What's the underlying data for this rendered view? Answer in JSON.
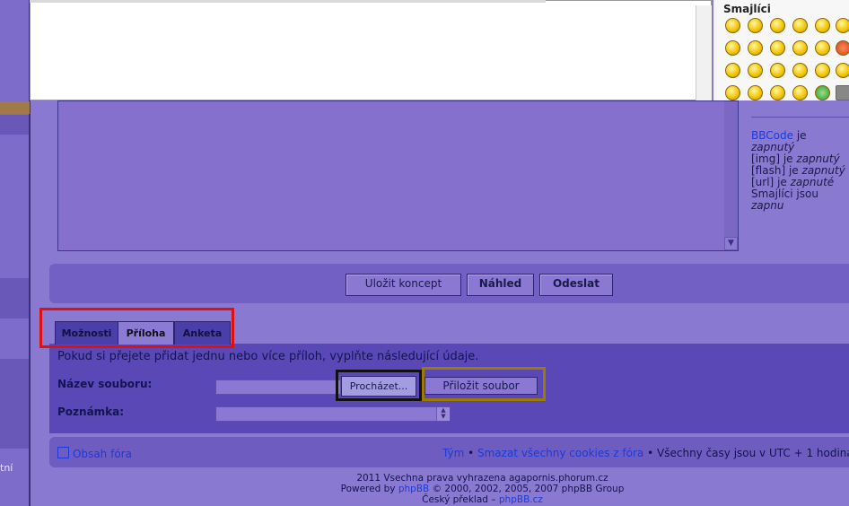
{
  "smilies": {
    "title": "Smajlíci"
  },
  "info": {
    "bbcode_label": "BBCode",
    "bbcode_state": "zapnutý",
    "img_label": "[img]",
    "img_state": "zapnutý",
    "flash_label": "[flash]",
    "flash_state": "zapnutý",
    "url_label": "[url]",
    "url_state": "zapnuté",
    "smilies_label": "Smajlíci jsou",
    "smilies_state": "zapnu",
    "connector": "je"
  },
  "buttons": {
    "draft": "Uložit koncept",
    "preview": "Náhled",
    "submit": "Odeslat"
  },
  "tabs": {
    "options": "Možnosti",
    "attachment": "Příloha",
    "poll": "Anketa"
  },
  "attachment": {
    "intro": "Pokud si přejete přidat jednu nebo více příloh, vyplňte následující údaje.",
    "filename_label": "Název souboru:",
    "comment_label": "Poznámka:",
    "browse": "Procházet...",
    "attach": "Přiložit soubor"
  },
  "footer": {
    "home": "Obsah fóra",
    "team": "Tým",
    "sep": "•",
    "delete_cookies": "Smazat všechny cookies z fóra",
    "timezone": "Všechny časy jsou v UTC + 1 hodina ["
  },
  "copyright": {
    "line1": "2011 Vsechna prava vyhrazena agapornis.phorum.cz",
    "powered_prefix": "Powered by",
    "phpbb": "phpBB",
    "powered_suffix": "© 2000, 2002, 2005, 2007 phpBB Group",
    "translation_prefix": "Český překlad –",
    "translation_link": "phpBB.cz"
  },
  "left": {
    "text": "tní"
  }
}
